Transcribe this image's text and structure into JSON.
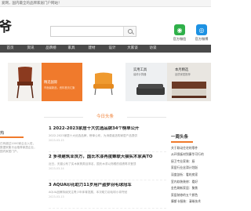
{
  "topbar": {
    "message": "爱网，国内最全的品牌家居门户网站！"
  },
  "logo": {
    "text": "爷"
  },
  "search": {
    "placeholder": ""
  },
  "qrcodes": [
    {
      "label": "官方微信",
      "color": "#2fb04a",
      "icon": "wechat-icon"
    },
    {
      "label": "官方微博",
      "color": "#1d92e3",
      "icon": "weibo-icon"
    }
  ],
  "nav": [
    "首页",
    "资讯",
    "品牌榜",
    "家具",
    "建材",
    "设计",
    "大家谈",
    "访谈"
  ],
  "banner": {
    "orange_title": "精选国际",
    "orange_sub": "市面最新品，资料首页汇聚",
    "gray_title": "实用工具",
    "gray_sub": "装修计算器",
    "right_title": "本月精选",
    "right_sub": "品质家居推荐"
  },
  "section": {
    "title": "今日头条"
  },
  "left_col": {
    "heading": "热",
    "snippets": [
      "已有超过1000家企业入驻，",
      "数据采集平台推荐家居企业，",
      "国内家居门户。"
    ]
  },
  "articles": [
    {
      "title": "1    2022-2023家居十大优选品牌34个榜单公开",
      "body": "2022-2023家居十大优选品牌，榜单公布，为消费者选购家居产品提供",
      "date": "2023-03-15"
    },
    {
      "title": "2    多项建筑业良方，国氏木漆再度蝉联天猫实木家具TO",
      "body": "近日，天猫公布了实木家具类目排名，国氏木漆以亮眼的成绩再次登顶",
      "date": "2023-03-14"
    },
    {
      "title": "3    AQUA印花助力11岁用户盗梦羽毛球冠军",
      "body": "AQUA品牌持续关注青少年体育发展，本次助力羽毛球小将夺冠",
      "date": "2023-03-13"
    }
  ],
  "right_col": {
    "heading": "一周头条",
    "items": [
      "关于联动住宅的零件",
      "从环保板材到康华可行的",
      "厨卫专业家装：厨",
      "家居行业丝滑计划跃",
      "深度剖析：看的房家",
      "室内软装装修：看好",
      "金色刷新家居：聚焦",
      "家居装修的五个颜色",
      "摩斯卡服装：清晰技术"
    ]
  }
}
